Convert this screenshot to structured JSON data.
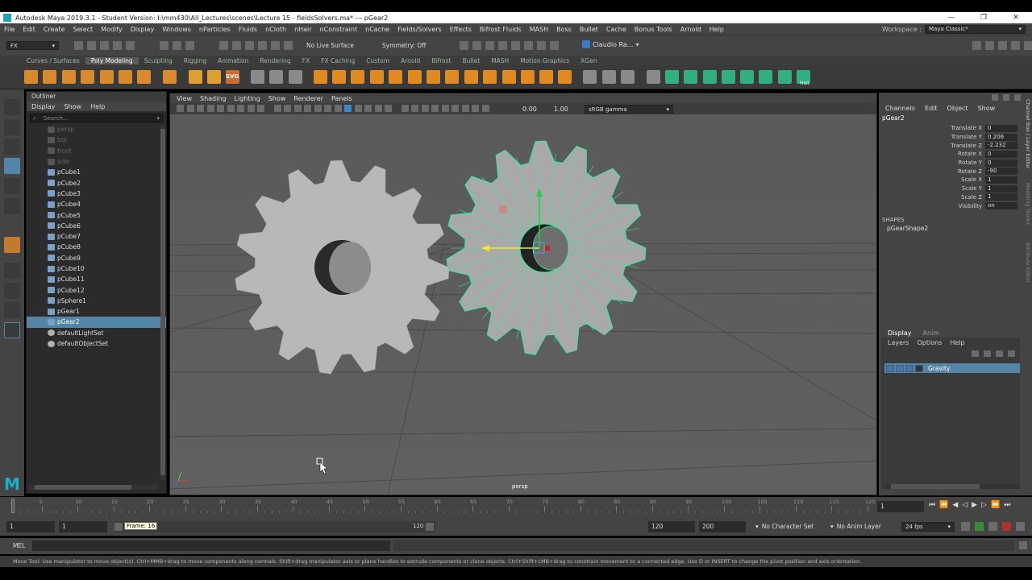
{
  "window": {
    "title": "Autodesk Maya 2019.3.1 - Student Version: I:\\mm430\\All_Lectures\\scenes\\Lecture 15 - fieldsSolvers.ma*   ---   pGear2",
    "minimize": "—",
    "maximize": "❐",
    "close": "✕"
  },
  "menubar": {
    "items": [
      "File",
      "Edit",
      "Create",
      "Select",
      "Modify",
      "Display",
      "Windows",
      "nParticles",
      "Fluids",
      "nCloth",
      "nHair",
      "nConstraint",
      "nCache",
      "Fields/Solvers",
      "Effects",
      "Bifrost Fluids",
      "MASH",
      "Boss",
      "Bullet",
      "Cache",
      "Bonus Tools",
      "Arnold",
      "Help"
    ],
    "workspace_label": "Workspace :",
    "workspace_value": "Maya Classic*"
  },
  "toolbar": {
    "menuset": "FX",
    "live_surface": "No Live Surface",
    "symmetry": "Symmetry: Off",
    "user": "Claudio Ra..."
  },
  "shelf": {
    "tabs": [
      "Curves / Surfaces",
      "Poly Modeling",
      "Sculpting",
      "Rigging",
      "Animation",
      "Rendering",
      "FX",
      "FX Caching",
      "Custom",
      "Arnold",
      "Bifrost",
      "Bullet",
      "MASH",
      "Motion Graphics",
      "XGen"
    ],
    "active": 1,
    "hist_label": "Hist",
    "svg_label": "SVG"
  },
  "outliner": {
    "title": "Outliner",
    "menu": [
      "Display",
      "Show",
      "Help"
    ],
    "search_placeholder": "Search...",
    "items": [
      {
        "name": "persp",
        "kind": "camera",
        "dim": true
      },
      {
        "name": "top",
        "kind": "camera",
        "dim": true
      },
      {
        "name": "front",
        "kind": "camera",
        "dim": true
      },
      {
        "name": "side",
        "kind": "camera",
        "dim": true
      },
      {
        "name": "pCube1",
        "kind": "mesh"
      },
      {
        "name": "pCube2",
        "kind": "mesh"
      },
      {
        "name": "pCube3",
        "kind": "mesh"
      },
      {
        "name": "pCube4",
        "kind": "mesh"
      },
      {
        "name": "pCube5",
        "kind": "mesh"
      },
      {
        "name": "pCube6",
        "kind": "mesh"
      },
      {
        "name": "pCube7",
        "kind": "mesh"
      },
      {
        "name": "pCube8",
        "kind": "mesh"
      },
      {
        "name": "pCube9",
        "kind": "mesh"
      },
      {
        "name": "pCube10",
        "kind": "mesh"
      },
      {
        "name": "pCube11",
        "kind": "mesh"
      },
      {
        "name": "pCube12",
        "kind": "mesh"
      },
      {
        "name": "pSphere1",
        "kind": "mesh"
      },
      {
        "name": "pGear1",
        "kind": "mesh"
      },
      {
        "name": "pGear2",
        "kind": "mesh",
        "selected": true
      },
      {
        "name": "defaultLightSet",
        "kind": "set"
      },
      {
        "name": "defaultObjectSet",
        "kind": "set"
      }
    ]
  },
  "viewport": {
    "menu": [
      "View",
      "Shading",
      "Lighting",
      "Show",
      "Renderer",
      "Panels"
    ],
    "field_a": "0.00",
    "field_b": "1.00",
    "color_space": "sRGB gamma",
    "camera_label": "persp"
  },
  "channel_box": {
    "menu": [
      "Channels",
      "Edit",
      "Object",
      "Show"
    ],
    "object": "pGear2",
    "attributes": [
      {
        "name": "Translate X",
        "value": "0"
      },
      {
        "name": "Translate Y",
        "value": "0.206"
      },
      {
        "name": "Translate Z",
        "value": "-2.232"
      },
      {
        "name": "Rotate X",
        "value": "0"
      },
      {
        "name": "Rotate Y",
        "value": "0"
      },
      {
        "name": "Rotate Z",
        "value": "-90"
      },
      {
        "name": "Scale X",
        "value": "1"
      },
      {
        "name": "Scale Y",
        "value": "1"
      },
      {
        "name": "Scale Z",
        "value": "1"
      },
      {
        "name": "Visibility",
        "value": "on"
      }
    ],
    "shapes_header": "SHAPES",
    "shape_name": "pGearShape2"
  },
  "side_tabs": [
    "Channel Box / Layer Editor",
    "Modeling Toolkit",
    "Attribute Editor"
  ],
  "layers": {
    "tabs": [
      "Display",
      "Anim"
    ],
    "menu": [
      "Layers",
      "Options",
      "Help"
    ],
    "layer_name": "Gravity"
  },
  "timeline": {
    "ticks": [
      "1",
      "5",
      "10",
      "15",
      "20",
      "25",
      "30",
      "35",
      "40",
      "45",
      "50",
      "55",
      "60",
      "65",
      "70",
      "75",
      "80",
      "85",
      "90",
      "95",
      "100",
      "105",
      "110",
      "115",
      "120"
    ],
    "current_frame": "1",
    "current_value": 1,
    "range_end_value": 120
  },
  "range": {
    "start": "1",
    "inner_start": "1",
    "frame_tooltip": "Frame: 16",
    "inner_end": "120",
    "end": "120",
    "max": "200",
    "character_set": "No Character Set",
    "anim_layer": "No Anim Layer",
    "fps": "24 fps"
  },
  "command": {
    "label": "MEL",
    "help": "Move Tool: Use manipulator to move object(s). Ctrl+MMB+drag to move components along normals. Shift+drag manipulator axis or plane handles to extrude components or clone objects. Ctrl+Shift+LMB+drag to constrain movement to a connected edge. Use D or INSERT to change the pivot position and axis orientation."
  },
  "colors": {
    "selection": "#5285a6",
    "wire": "#30f0a0",
    "panel": "#444444",
    "viewport_bg": "#5f5f5f",
    "gear": "#b8b8b8"
  }
}
